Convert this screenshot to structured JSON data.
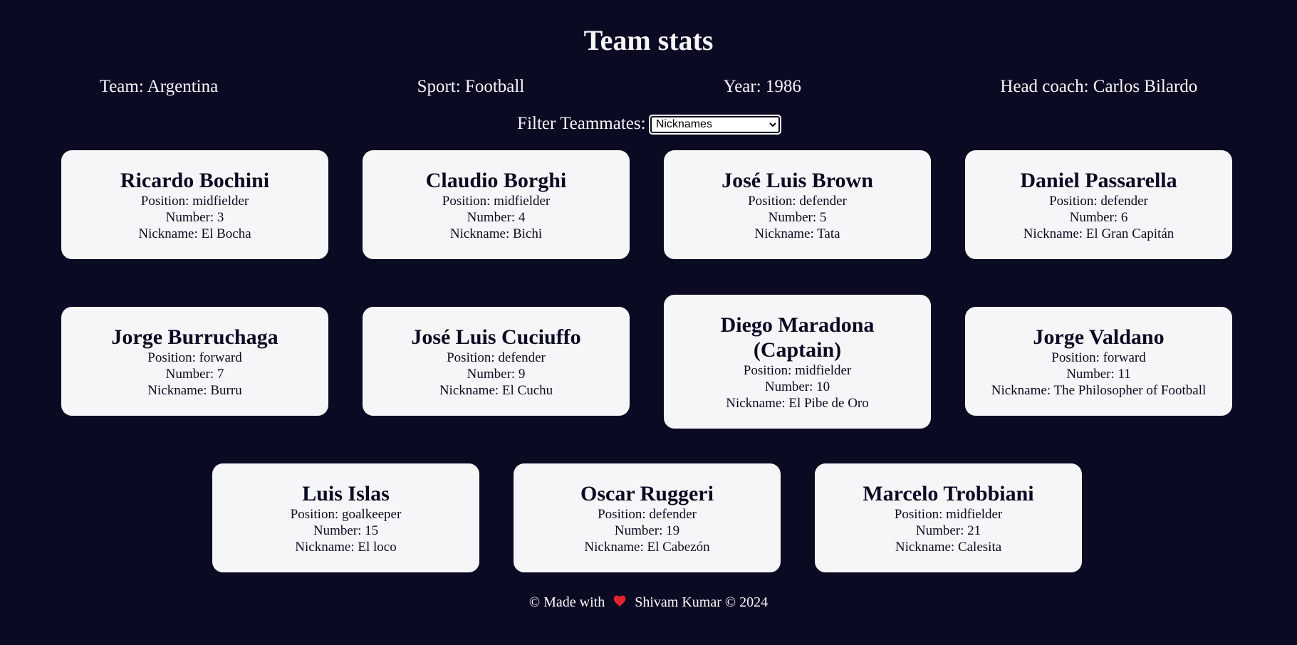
{
  "page": {
    "title": "Team stats"
  },
  "team_info": {
    "team": "Team: Argentina",
    "sport": "Sport: Football",
    "year": "Year: 1986",
    "head_coach": "Head coach: Carlos Bilardo"
  },
  "filter": {
    "label": "Filter Teammates:",
    "selected": "Nicknames"
  },
  "players": [
    {
      "name": "Ricardo Bochini",
      "position": "Position: midfielder",
      "number": "Number: 3",
      "nickname": "Nickname: El Bocha"
    },
    {
      "name": "Claudio Borghi",
      "position": "Position: midfielder",
      "number": "Number: 4",
      "nickname": "Nickname: Bichi"
    },
    {
      "name": "José Luis Brown",
      "position": "Position: defender",
      "number": "Number: 5",
      "nickname": "Nickname: Tata"
    },
    {
      "name": "Daniel Passarella",
      "position": "Position: defender",
      "number": "Number: 6",
      "nickname": "Nickname: El Gran Capitán"
    },
    {
      "name": "Jorge Burruchaga",
      "position": "Position: forward",
      "number": "Number: 7",
      "nickname": "Nickname: Burru"
    },
    {
      "name": "José Luis Cuciuffo",
      "position": "Position: defender",
      "number": "Number: 9",
      "nickname": "Nickname: El Cuchu"
    },
    {
      "name": "Diego Maradona (Captain)",
      "position": "Position: midfielder",
      "number": "Number: 10",
      "nickname": "Nickname: El Pibe de Oro"
    },
    {
      "name": "Jorge Valdano",
      "position": "Position: forward",
      "number": "Number: 11",
      "nickname": "Nickname: The Philosopher of Football"
    },
    {
      "name": "Luis Islas",
      "position": "Position: goalkeeper",
      "number": "Number: 15",
      "nickname": "Nickname: El loco"
    },
    {
      "name": "Oscar Ruggeri",
      "position": "Position: defender",
      "number": "Number: 19",
      "nickname": "Nickname: El Cabezón"
    },
    {
      "name": "Marcelo Trobbiani",
      "position": "Position: midfielder",
      "number": "Number: 21",
      "nickname": "Nickname: Calesita"
    }
  ],
  "footer": {
    "prefix": "© Made with",
    "suffix": "Shivam Kumar © 2024",
    "heart_icon": "heart-icon",
    "heart_color": "#e0242f"
  },
  "colors": {
    "background": "#0a0a23",
    "card": "#f5f6f7",
    "text_dark": "#0a0a23"
  }
}
